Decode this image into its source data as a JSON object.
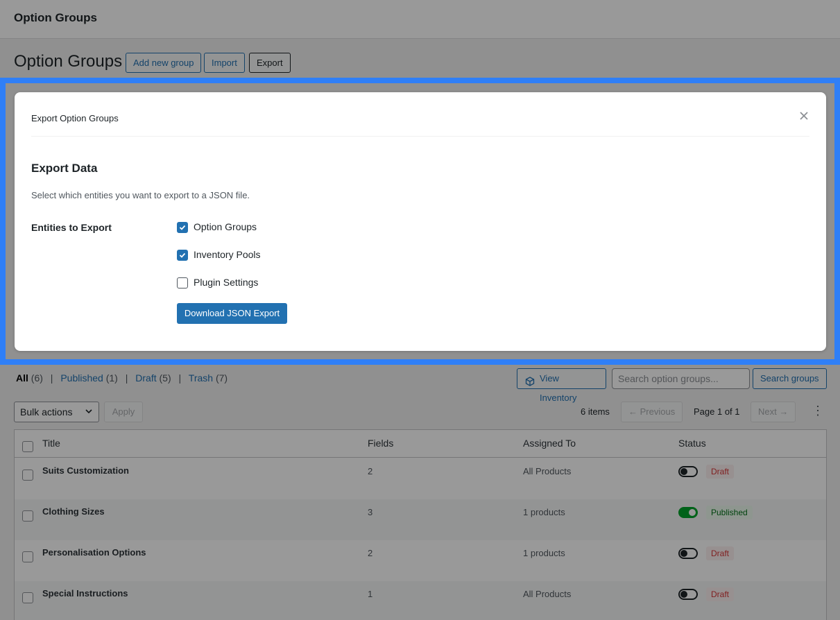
{
  "topbar": {
    "title": "Option Groups"
  },
  "header": {
    "title": "Option Groups",
    "add_new_label": "Add new group",
    "import_label": "Import",
    "export_label": "Export"
  },
  "filters": {
    "all": {
      "label": "All",
      "count": "(6)"
    },
    "published": {
      "label": "Published",
      "count": "(1)"
    },
    "draft": {
      "label": "Draft",
      "count": "(5)"
    },
    "trash": {
      "label": "Trash",
      "count": "(7)"
    },
    "separator": "|"
  },
  "toolbar": {
    "view_inventory_label": "View Inventory",
    "search_placeholder": "Search option groups...",
    "search_button_label": "Search groups",
    "bulk_actions_label": "Bulk actions",
    "apply_label": "Apply",
    "items_count": "6 items",
    "previous_label": "← Previous",
    "page_label": "Page 1 of 1",
    "next_label": "Next →"
  },
  "table": {
    "columns": [
      "Title",
      "Fields",
      "Assigned To",
      "Status"
    ],
    "rows": [
      {
        "title": "Suits Customization",
        "fields": "2",
        "assigned": "All Products",
        "status": "Draft",
        "enabled": false
      },
      {
        "title": "Clothing Sizes",
        "fields": "3",
        "assigned": "1 products",
        "status": "Published",
        "enabled": true
      },
      {
        "title": "Personalisation Options",
        "fields": "2",
        "assigned": "1 products",
        "status": "Draft",
        "enabled": false
      },
      {
        "title": "Special Instructions",
        "fields": "1",
        "assigned": "All Products",
        "status": "Draft",
        "enabled": false
      }
    ]
  },
  "modal": {
    "title": "Export Option Groups",
    "close_icon": "close-icon",
    "heading": "Export Data",
    "description": "Select which entities you want to export to a JSON file.",
    "entities_label": "Entities to Export",
    "options": [
      {
        "label": "Option Groups",
        "checked": true
      },
      {
        "label": "Inventory Pools",
        "checked": true
      },
      {
        "label": "Plugin Settings",
        "checked": false
      }
    ],
    "download_label": "Download JSON Export"
  },
  "colors": {
    "accent": "#2271b1",
    "highlight": "#2f7ff7",
    "published": "#00a32a",
    "draft": "#d63638"
  }
}
